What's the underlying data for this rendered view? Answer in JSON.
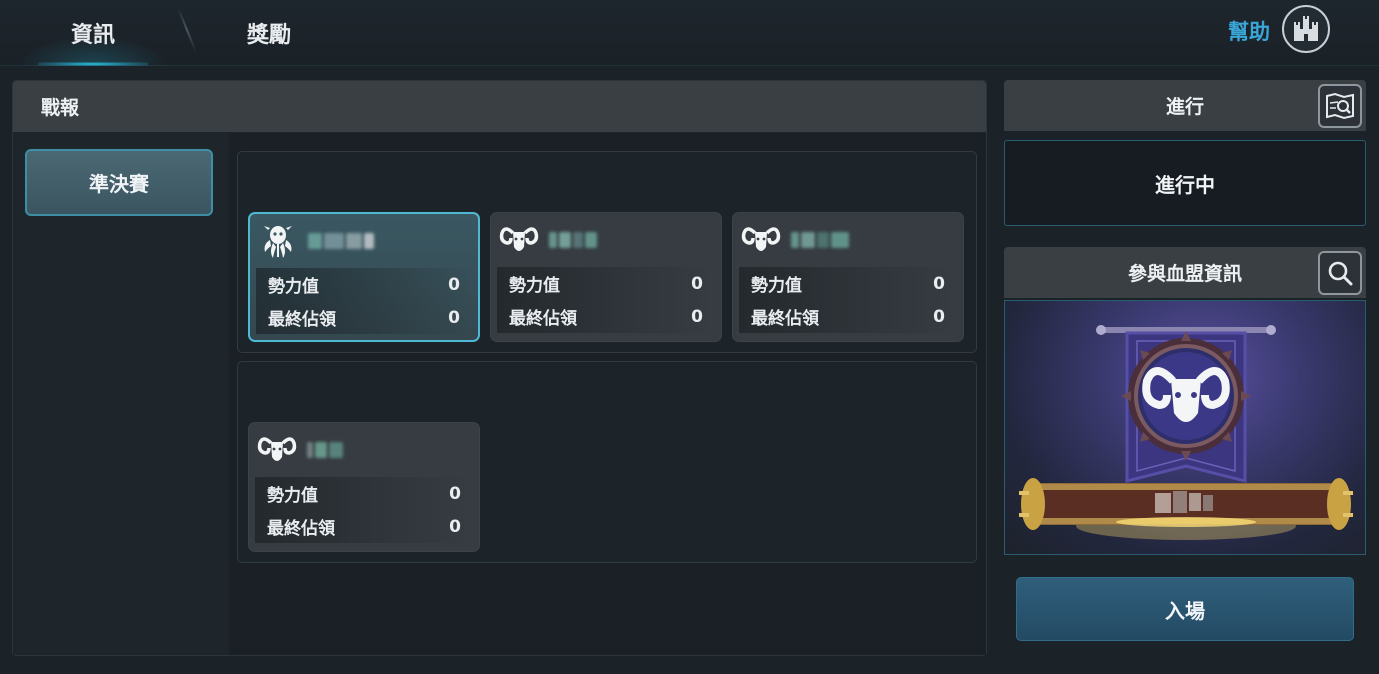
{
  "tabs": [
    {
      "label": "資訊",
      "active": true
    },
    {
      "label": "獎勵",
      "active": false
    }
  ],
  "help": {
    "label": "幫助",
    "icon": "castle-icon"
  },
  "battle_report": {
    "header": "戰報",
    "round_button": "準決賽",
    "groups": [
      {
        "cards": [
          {
            "emblem": "octopus-emblem-icon",
            "selected": true,
            "power_label": "勢力值",
            "power_value": "0",
            "occupy_label": "最終佔領",
            "occupy_value": "0"
          },
          {
            "emblem": "ram-emblem-icon",
            "selected": false,
            "power_label": "勢力值",
            "power_value": "0",
            "occupy_label": "最終佔領",
            "occupy_value": "0"
          },
          {
            "emblem": "ram-emblem-icon",
            "selected": false,
            "power_label": "勢力值",
            "power_value": "0",
            "occupy_label": "最終佔領",
            "occupy_value": "0"
          }
        ]
      },
      {
        "cards": [
          {
            "emblem": "ram-emblem-icon",
            "selected": false,
            "power_label": "勢力值",
            "power_value": "0",
            "occupy_label": "最終佔領",
            "occupy_value": "0"
          }
        ]
      }
    ]
  },
  "progress": {
    "header": "進行",
    "status": "進行中",
    "icon": "map-search-icon"
  },
  "clan_info": {
    "header": "參與血盟資訊",
    "icon": "search-icon",
    "emblem": "ram-emblem-icon"
  },
  "enter_button": "入場",
  "colors": {
    "accent": "#28c6e8",
    "help_text": "#3aa6d8",
    "banner_purple": "#3c3580",
    "scroll_gold": "#c9a244"
  }
}
